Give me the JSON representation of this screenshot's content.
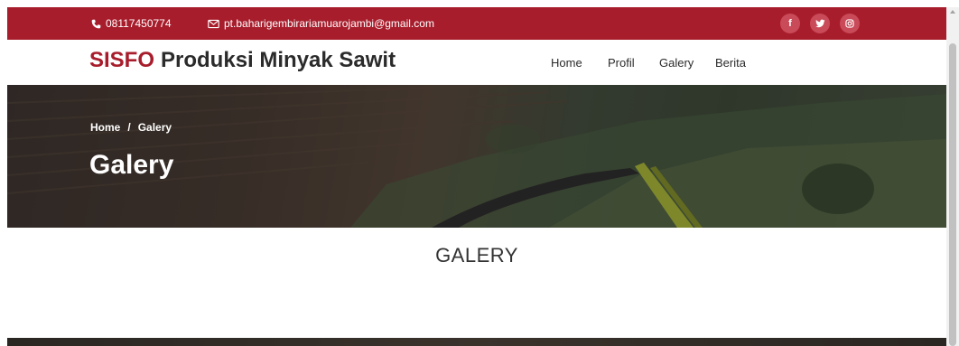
{
  "topbar": {
    "phone": "08117450774",
    "email": "pt.baharigembirariamuarojambi@gmail.com",
    "social": [
      {
        "icon": "facebook-icon",
        "glyph": "f"
      },
      {
        "icon": "twitter-icon",
        "glyph": "t"
      },
      {
        "icon": "instagram-icon",
        "glyph": "o"
      }
    ],
    "bg_color": "#a81d2c"
  },
  "brand": {
    "accent": "SISFO",
    "name": "Produksi Minyak Sawit",
    "accent_color": "#a81d2c"
  },
  "nav": {
    "items": [
      "Home",
      "Profil",
      "Galery",
      "Berita"
    ]
  },
  "hero": {
    "breadcrumb_home": "Home",
    "breadcrumb_sep": "/",
    "breadcrumb_current": "Galery",
    "title": "Galery"
  },
  "section": {
    "title": "GALERY"
  }
}
